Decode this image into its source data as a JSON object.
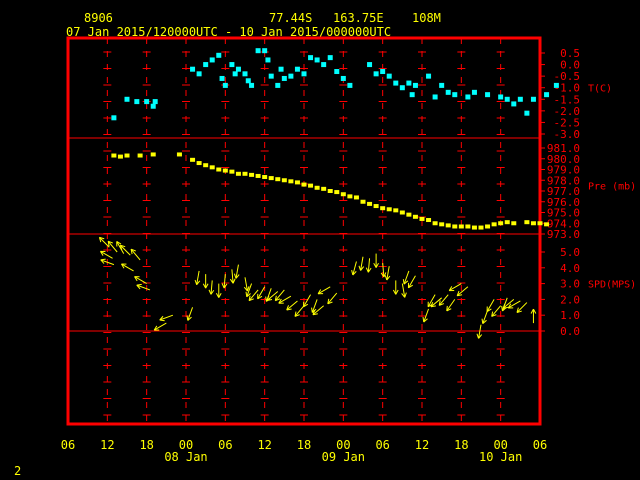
{
  "header": {
    "station": "8906",
    "lat": "77.44S",
    "lon": "163.75E",
    "elev": "108M",
    "period": "07 Jan 2015/120000UTC - 10 Jan 2015/000000UTC"
  },
  "footer": {
    "page_number": "2"
  },
  "colors": {
    "frame": "#ff0000",
    "temp": "#00ffff",
    "pressure": "#ffff00",
    "wind": "#ffff00",
    "axis_text": "#ffff00",
    "label_text": "#ff0000"
  },
  "chart_data": {
    "type": "scatter",
    "x_axis": {
      "range_hours": [
        -6,
        66
      ],
      "ticks": [
        {
          "h": -6,
          "label": "06"
        },
        {
          "h": 0,
          "label": "12"
        },
        {
          "h": 6,
          "label": "18"
        },
        {
          "h": 12,
          "label": "00"
        },
        {
          "h": 18,
          "label": "06"
        },
        {
          "h": 24,
          "label": "12"
        },
        {
          "h": 30,
          "label": "18"
        },
        {
          "h": 36,
          "label": "00"
        },
        {
          "h": 42,
          "label": "06"
        },
        {
          "h": 48,
          "label": "12"
        },
        {
          "h": 54,
          "label": "18"
        },
        {
          "h": 60,
          "label": "00"
        },
        {
          "h": 66,
          "label": "06"
        }
      ],
      "day_labels": [
        {
          "h": 12,
          "label": "08 Jan"
        },
        {
          "h": 36,
          "label": "09 Jan"
        },
        {
          "h": 60,
          "label": "10 Jan"
        }
      ]
    },
    "panels": [
      {
        "name": "temperature",
        "label": "T(C)",
        "range": [
          -3.0,
          0.5
        ],
        "ticks": [
          "0.5",
          "0.0",
          "-0.5",
          "-1.0",
          "-1.5",
          "-2.0",
          "-2.5",
          "-3.0"
        ],
        "tick_values": [
          0.5,
          0,
          -0.5,
          -1.0,
          -1.5,
          -2.0,
          -2.5,
          -3.0
        ],
        "label_value": -1.0,
        "points": [
          [
            1,
            -2.3
          ],
          [
            3,
            -1.5
          ],
          [
            4.5,
            -1.6
          ],
          [
            6,
            -1.6
          ],
          [
            7,
            -1.8
          ],
          [
            7.3,
            -1.6
          ],
          [
            13,
            -0.2
          ],
          [
            14,
            -0.4
          ],
          [
            15,
            0.0
          ],
          [
            16,
            0.2
          ],
          [
            17,
            0.4
          ],
          [
            17.5,
            -0.6
          ],
          [
            18,
            -0.9
          ],
          [
            19,
            0.0
          ],
          [
            19.5,
            -0.4
          ],
          [
            20,
            -0.2
          ],
          [
            21,
            -0.4
          ],
          [
            21.5,
            -0.7
          ],
          [
            22,
            -0.9
          ],
          [
            23,
            0.6
          ],
          [
            24,
            0.6
          ],
          [
            24.5,
            0.2
          ],
          [
            25,
            -0.5
          ],
          [
            26,
            -0.9
          ],
          [
            26.5,
            -0.2
          ],
          [
            27,
            -0.6
          ],
          [
            28,
            -0.5
          ],
          [
            29,
            -0.2
          ],
          [
            30,
            -0.4
          ],
          [
            31,
            0.3
          ],
          [
            32,
            0.2
          ],
          [
            33,
            0.0
          ],
          [
            34,
            0.3
          ],
          [
            35,
            -0.3
          ],
          [
            36,
            -0.6
          ],
          [
            37,
            -0.9
          ],
          [
            40,
            0.0
          ],
          [
            41,
            -0.4
          ],
          [
            42,
            -0.3
          ],
          [
            43,
            -0.5
          ],
          [
            44,
            -0.8
          ],
          [
            45,
            -1.0
          ],
          [
            46,
            -0.8
          ],
          [
            46.5,
            -1.3
          ],
          [
            47,
            -0.9
          ],
          [
            49,
            -0.5
          ],
          [
            50,
            -1.4
          ],
          [
            51,
            -0.9
          ],
          [
            52,
            -1.2
          ],
          [
            53,
            -1.3
          ],
          [
            55,
            -1.4
          ],
          [
            56,
            -1.2
          ],
          [
            58,
            -1.3
          ],
          [
            60,
            -1.4
          ],
          [
            61,
            -1.5
          ],
          [
            62,
            -1.7
          ],
          [
            63,
            -1.5
          ],
          [
            64,
            -2.1
          ],
          [
            65,
            -1.5
          ],
          [
            67,
            -1.3
          ],
          [
            68.5,
            -0.9
          ]
        ]
      },
      {
        "name": "pressure",
        "label": "Pre (mb)",
        "range": [
          973.0,
          981.0
        ],
        "ticks": [
          "981.0",
          "980.0",
          "979.0",
          "978.0",
          "977.0",
          "976.0",
          "975.0",
          "974.0",
          "973.0"
        ],
        "tick_values": [
          981,
          980,
          979,
          978,
          977,
          976,
          975,
          974,
          973
        ],
        "label_value": 977.5,
        "points": [
          [
            1,
            980.3
          ],
          [
            2,
            980.2
          ],
          [
            3,
            980.3
          ],
          [
            5,
            980.3
          ],
          [
            7,
            980.4
          ],
          [
            11,
            980.4
          ],
          [
            13,
            979.9
          ],
          [
            14,
            979.6
          ],
          [
            15,
            979.4
          ],
          [
            16,
            979.2
          ],
          [
            17,
            979.0
          ],
          [
            18,
            978.9
          ],
          [
            19,
            978.8
          ],
          [
            20,
            978.6
          ],
          [
            21,
            978.6
          ],
          [
            22,
            978.5
          ],
          [
            23,
            978.4
          ],
          [
            24,
            978.3
          ],
          [
            25,
            978.2
          ],
          [
            26,
            978.1
          ],
          [
            27,
            978.0
          ],
          [
            28,
            977.9
          ],
          [
            29,
            977.8
          ],
          [
            30,
            977.6
          ],
          [
            31,
            977.5
          ],
          [
            32,
            977.3
          ],
          [
            33,
            977.2
          ],
          [
            34,
            977.0
          ],
          [
            35,
            976.9
          ],
          [
            36,
            976.7
          ],
          [
            37,
            976.5
          ],
          [
            38,
            976.4
          ],
          [
            39,
            976.0
          ],
          [
            40,
            975.8
          ],
          [
            41,
            975.6
          ],
          [
            42,
            975.4
          ],
          [
            43,
            975.3
          ],
          [
            44,
            975.2
          ],
          [
            45,
            975.0
          ],
          [
            46,
            974.8
          ],
          [
            47,
            974.6
          ],
          [
            48,
            974.4
          ],
          [
            49,
            974.3
          ],
          [
            50,
            974.0
          ],
          [
            51,
            973.9
          ],
          [
            52,
            973.8
          ],
          [
            53,
            973.7
          ],
          [
            54,
            973.7
          ],
          [
            55,
            973.7
          ],
          [
            56,
            973.6
          ],
          [
            57,
            973.6
          ],
          [
            58,
            973.7
          ],
          [
            59,
            973.9
          ],
          [
            60,
            974.0
          ],
          [
            61,
            974.1
          ],
          [
            62,
            974.0
          ],
          [
            64,
            974.1
          ],
          [
            65,
            974.0
          ],
          [
            66,
            974.0
          ],
          [
            67,
            973.9
          ]
        ]
      },
      {
        "name": "wind",
        "label": "SPD(MPS)",
        "range": [
          -6.5,
          6.0
        ],
        "ticks": [
          "5.0",
          "4.0",
          "3.0",
          "2.0",
          "1.0",
          "0.0"
        ],
        "tick_values": [
          5,
          4,
          3,
          2,
          1,
          0
        ],
        "label_value": 3.0,
        "barbs": [
          [
            0.3,
            5.3,
            315
          ],
          [
            0.8,
            4.6,
            300
          ],
          [
            1,
            4.2,
            290
          ],
          [
            1.5,
            5.0,
            320
          ],
          [
            2.5,
            4.9,
            330
          ],
          [
            3.5,
            4.8,
            315
          ],
          [
            4,
            3.8,
            300
          ],
          [
            5,
            4.5,
            320
          ],
          [
            6,
            3.0,
            300
          ],
          [
            6.5,
            2.6,
            290
          ],
          [
            9,
            0.5,
            240
          ],
          [
            10,
            1.0,
            250
          ],
          [
            13,
            1.5,
            200
          ],
          [
            14,
            3.8,
            190
          ],
          [
            15,
            3.6,
            180
          ],
          [
            16,
            3.2,
            185
          ],
          [
            17,
            3.0,
            180
          ],
          [
            18,
            3.6,
            185
          ],
          [
            19,
            3.9,
            175
          ],
          [
            20,
            4.2,
            190
          ],
          [
            21,
            3.4,
            170
          ],
          [
            22,
            3.0,
            200
          ],
          [
            23,
            2.6,
            220
          ],
          [
            24,
            2.8,
            210
          ],
          [
            25,
            2.7,
            200
          ],
          [
            26,
            2.5,
            230
          ],
          [
            27,
            2.6,
            220
          ],
          [
            28,
            2.2,
            240
          ],
          [
            29,
            1.9,
            230
          ],
          [
            30,
            1.6,
            220
          ],
          [
            31,
            2.3,
            210
          ],
          [
            32,
            2.0,
            200
          ],
          [
            33,
            1.6,
            230
          ],
          [
            34,
            2.8,
            240
          ],
          [
            35,
            2.4,
            220
          ],
          [
            38,
            4.4,
            195
          ],
          [
            39,
            4.7,
            190
          ],
          [
            40,
            4.6,
            185
          ],
          [
            41,
            4.9,
            180
          ],
          [
            42,
            4.3,
            175
          ],
          [
            43,
            4.1,
            190
          ],
          [
            44,
            3.2,
            180
          ],
          [
            45,
            3.0,
            170
          ],
          [
            46,
            3.8,
            200
          ],
          [
            47,
            3.5,
            210
          ],
          [
            49,
            1.4,
            200
          ],
          [
            50,
            2.3,
            210
          ],
          [
            51,
            2.1,
            230
          ],
          [
            52,
            2.3,
            220
          ],
          [
            53,
            2.0,
            215
          ],
          [
            54,
            3.0,
            240
          ],
          [
            55,
            2.8,
            230
          ],
          [
            57,
            0.4,
            190
          ],
          [
            58,
            1.3,
            200
          ],
          [
            59,
            2.0,
            210
          ],
          [
            60,
            1.6,
            220
          ],
          [
            61,
            2.1,
            200
          ],
          [
            62,
            2.0,
            230
          ],
          [
            63,
            1.9,
            240
          ],
          [
            64,
            1.8,
            225
          ],
          [
            65,
            0.5,
            0
          ]
        ]
      }
    ]
  }
}
